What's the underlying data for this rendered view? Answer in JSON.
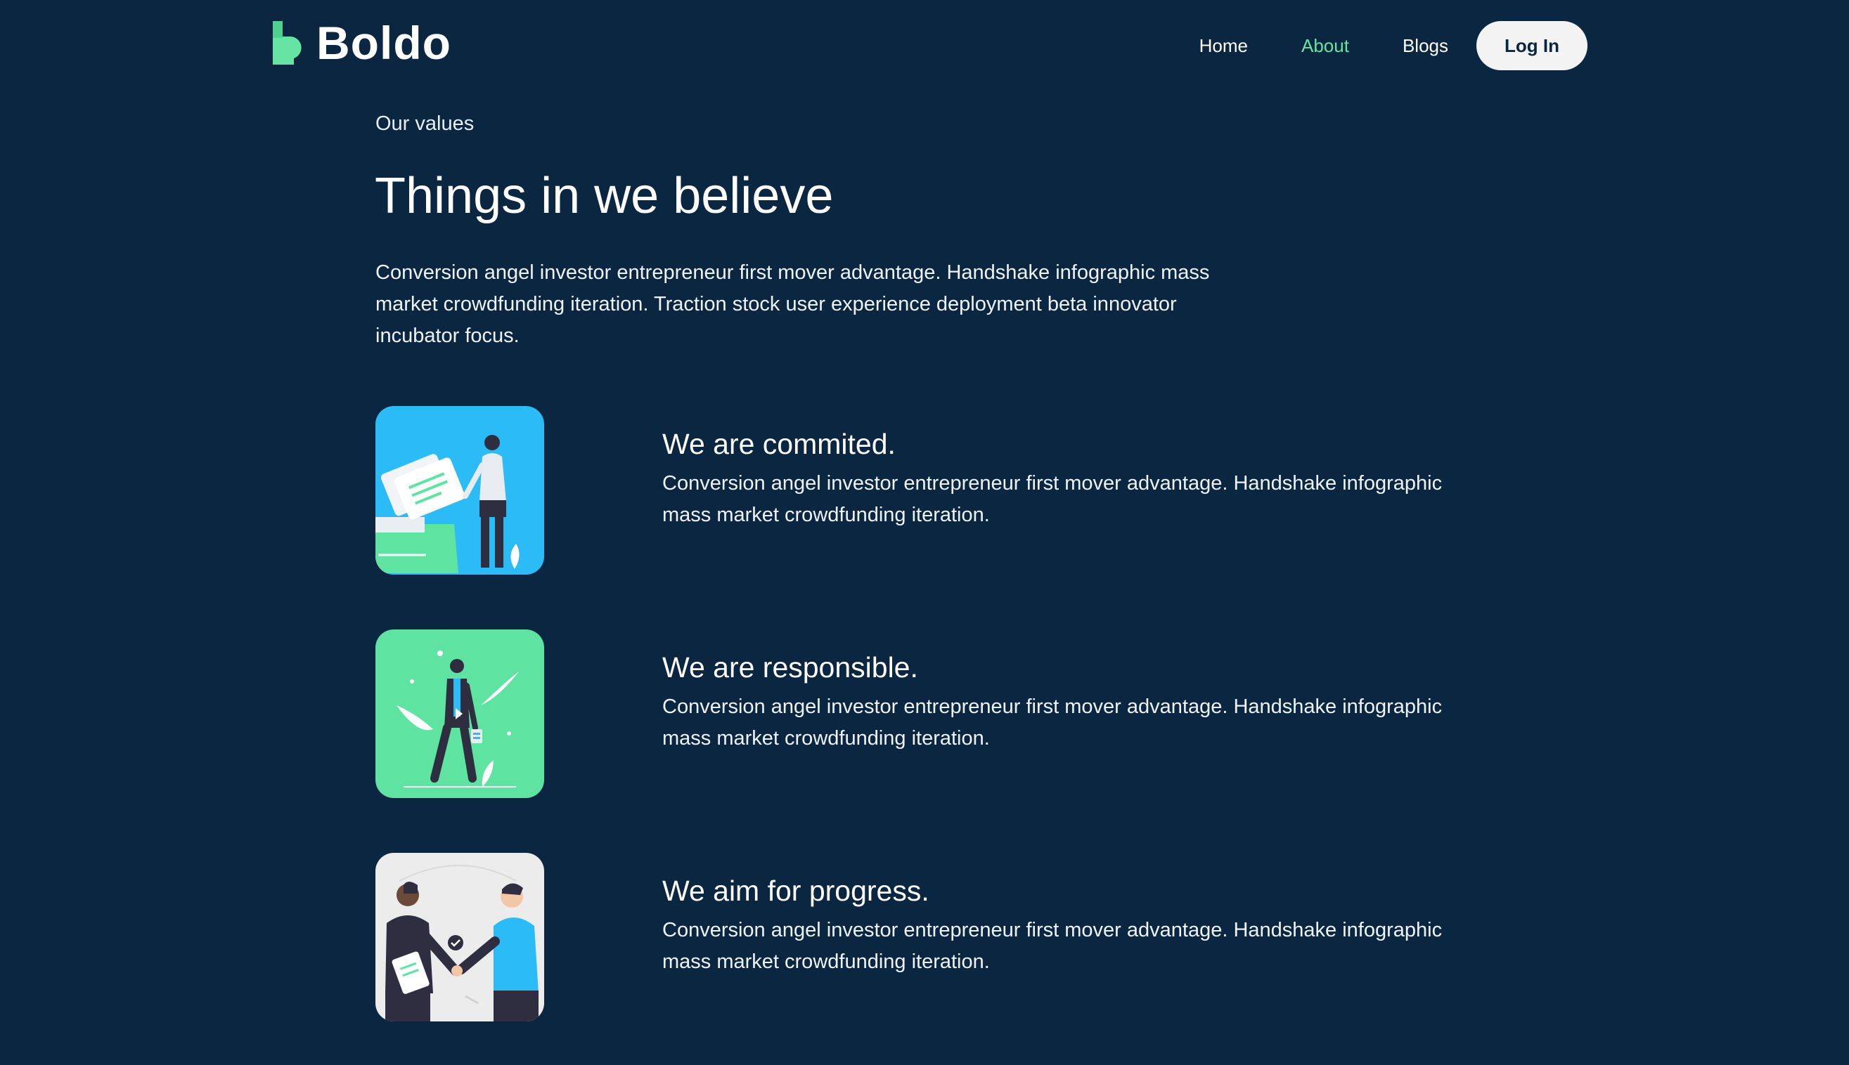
{
  "brand": {
    "name": "Boldo",
    "accent_color": "#65e4a3",
    "background_color": "#0b2640"
  },
  "nav": {
    "items": [
      {
        "label": "Home",
        "active": false
      },
      {
        "label": "About",
        "active": true
      },
      {
        "label": "Blogs",
        "active": false
      }
    ],
    "login_label": "Log In"
  },
  "intro": {
    "eyebrow": "Our values",
    "headline": "Things in we believe",
    "text": "Conversion angel investor entrepreneur first mover advantage. Handshake infographic mass market crowdfunding iteration. Traction stock user experience deployment beta innovator incubator focus."
  },
  "values": [
    {
      "title": "We are commited.",
      "text": "Conversion angel investor entrepreneur first mover advantage. Handshake infographic mass market crowdfunding iteration.",
      "image_color": "#2bbcf7"
    },
    {
      "title": "We are responsible.",
      "text": "Conversion angel investor entrepreneur first mover advantage. Handshake infographic mass market crowdfunding iteration.",
      "image_color": "#5ee3a1"
    },
    {
      "title": "We aim for progress.",
      "text": "Conversion angel investor entrepreneur first mover advantage. Handshake infographic mass market crowdfunding iteration.",
      "image_color": "#ececec"
    }
  ]
}
